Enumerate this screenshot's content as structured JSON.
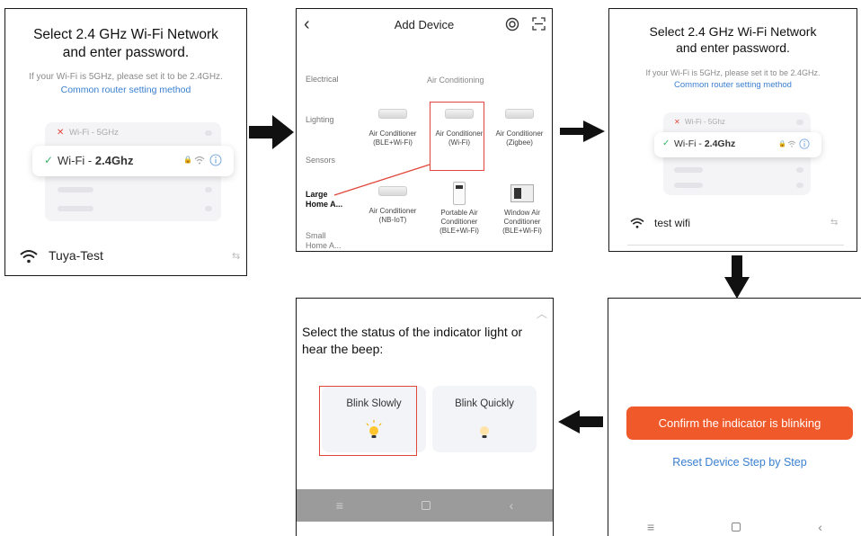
{
  "screen1": {
    "title_line1": "Select 2.4 GHz Wi-Fi Network",
    "title_line2": "and enter password.",
    "hint": "If your Wi-Fi is 5GHz, please set it to be 2.4GHz.",
    "link": "Common router setting method",
    "network_5g": "Wi-Fi - 5GHz",
    "network_24_prefix": "Wi-Fi - ",
    "network_24_band": "2.4Ghz",
    "ssid": "Tuya-Test"
  },
  "screen2": {
    "title": "Add Device",
    "categories": [
      "Electrical",
      "Lighting",
      "Sensors",
      "Large Home A...",
      "Small Home A..."
    ],
    "section_label": "Air Conditioning",
    "devices": [
      {
        "name": "Air Conditioner",
        "variant": "(BLE+Wi-Fi)"
      },
      {
        "name": "Air Conditioner",
        "variant": "(Wi-Fi)"
      },
      {
        "name": "Air Conditioner",
        "variant": "(Zigbee)"
      },
      {
        "name": "Air Conditioner",
        "variant": "(NB-IoT)"
      },
      {
        "name": "Portable Air Conditioner",
        "variant": "(BLE+Wi-Fi)"
      },
      {
        "name": "Window Air Conditioner",
        "variant": "(BLE+Wi-Fi)"
      }
    ]
  },
  "screen3": {
    "title_line1": "Select 2.4 GHz Wi-Fi Network",
    "title_line2": "and enter password.",
    "hint": "If your Wi-Fi is 5GHz, please set it to be 2.4GHz.",
    "link": "Common router setting method",
    "network_5g": "Wi-Fi - 5Ghz",
    "network_24_prefix": "Wi-Fi - ",
    "network_24_band": "2.4Ghz",
    "ssid": "test wifi"
  },
  "screen4": {
    "confirm_button": "Confirm the indicator is blinking",
    "reset_link": "Reset Device Step by Step"
  },
  "screen5": {
    "prompt": "Select the status of the indicator light or hear the beep:",
    "option_slow": "Blink Slowly",
    "option_quick": "Blink Quickly"
  },
  "colors": {
    "accent_orange": "#f0592a",
    "link_blue": "#3a7fd0",
    "highlight_red": "#e0463a",
    "check_green": "#3bb36a",
    "nav_gray": "#9a9a9a"
  },
  "icons": [
    "check-icon",
    "close-x-icon",
    "lock-icon",
    "wifi-icon",
    "info-icon",
    "switch-icon",
    "back-chevron-icon",
    "target-icon",
    "scan-icon",
    "bulb-icon",
    "menu-icon",
    "home-square-icon"
  ]
}
